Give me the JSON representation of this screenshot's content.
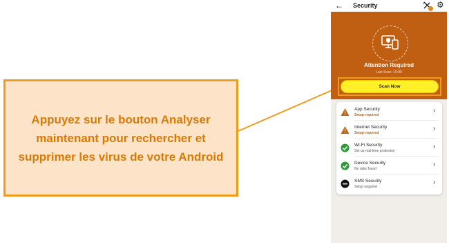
{
  "callout": {
    "text": "Appuyez sur le bouton Analyser maintenant pour rechercher et supprimer les virus de votre Android"
  },
  "app": {
    "title": "Security",
    "status_title": "Attention Required",
    "last_scan": "Last Scan: 19:09",
    "scan_button": "Scan Now",
    "colors": {
      "header": "#c05e12",
      "button": "#fff02a",
      "warning": "#c0650f",
      "ok": "#2e9b3a",
      "accent": "#f09a1e"
    }
  },
  "icons": {
    "back": "back-arrow-icon",
    "tools": "tools-icon",
    "settings": "gear-icon"
  },
  "items": [
    {
      "title": "App Security",
      "subtitle": "Setup required",
      "status": "warning"
    },
    {
      "title": "Internet Security",
      "subtitle": "Setup required",
      "status": "warning"
    },
    {
      "title": "Wi-Fi Security",
      "subtitle": "Set up real-time protection",
      "status": "ok"
    },
    {
      "title": "Device Security",
      "subtitle": "No risks found",
      "status": "ok"
    },
    {
      "title": "SMS Security",
      "subtitle": "Setup required",
      "status": "blocked"
    }
  ]
}
